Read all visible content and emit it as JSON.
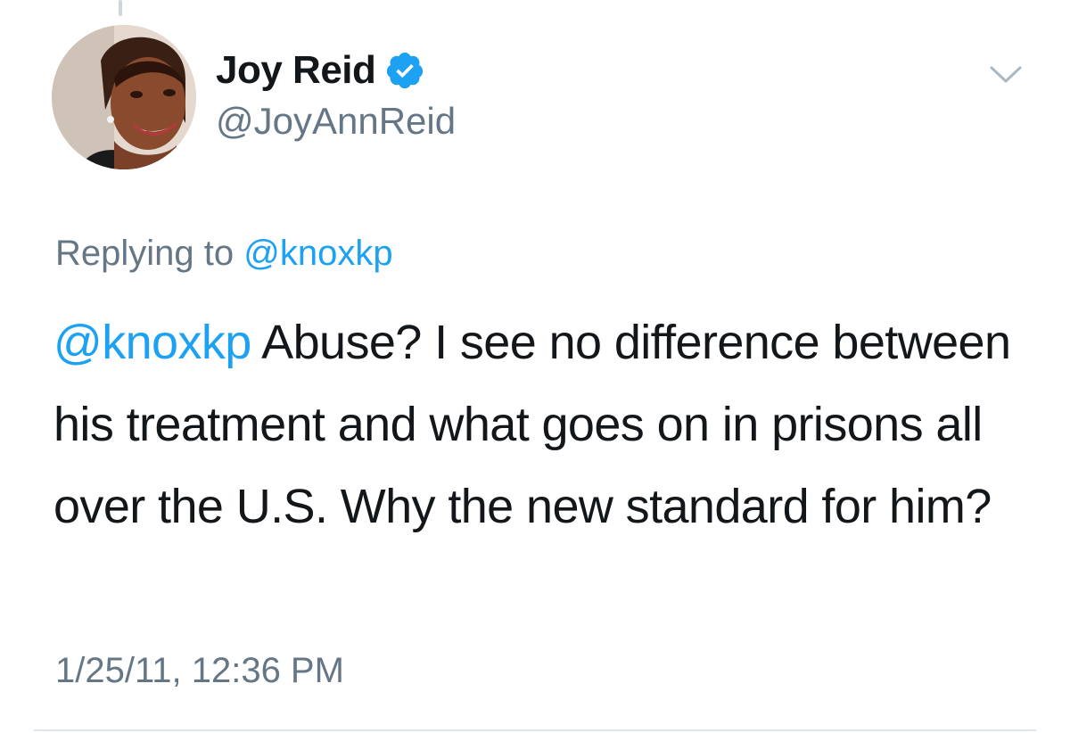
{
  "author": {
    "name": "Joy Reid",
    "handle": "@JoyAnnReid",
    "verified": true
  },
  "reply": {
    "prefix": "Replying to",
    "mention": "@knoxkp"
  },
  "tweet": {
    "mention": "@knoxkp",
    "text": "Abuse? I see no difference between his treatment and what goes on in prisons all over the U.S. Why the new standard for him?"
  },
  "timestamp": "1/25/11, 12:36 PM",
  "colors": {
    "link": "#1da1f2",
    "secondary_text": "#657786",
    "primary_text": "#14171a",
    "verified_badge": "#1da1f2",
    "divider": "#e1e8ed"
  },
  "icons": {
    "verified": "verified-badge-icon",
    "more": "chevron-down-icon"
  }
}
